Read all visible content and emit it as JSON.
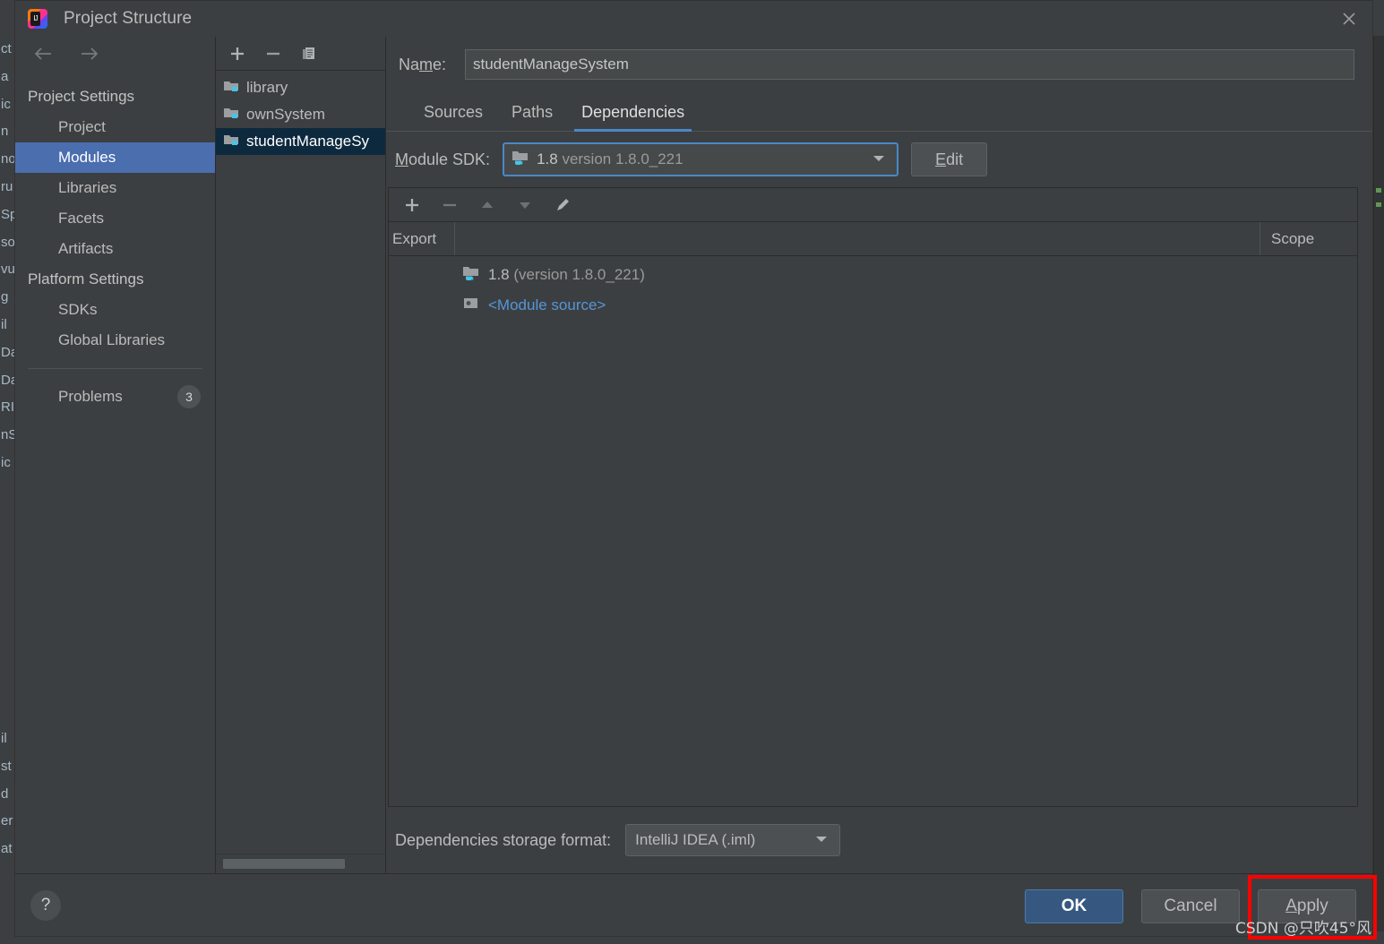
{
  "window": {
    "title": "Project Structure",
    "logo_icon": "intellij-idea-logo",
    "close_icon": "close-icon"
  },
  "sidebar": {
    "back_icon": "arrow-left-icon",
    "forward_icon": "arrow-right-icon",
    "items": [
      {
        "label": "Project Settings",
        "type": "group"
      },
      {
        "label": "Project",
        "type": "child"
      },
      {
        "label": "Modules",
        "type": "child",
        "selected": true
      },
      {
        "label": "Libraries",
        "type": "child"
      },
      {
        "label": "Facets",
        "type": "child"
      },
      {
        "label": "Artifacts",
        "type": "child"
      },
      {
        "label": "Platform Settings",
        "type": "group"
      },
      {
        "label": "SDKs",
        "type": "child"
      },
      {
        "label": "Global Libraries",
        "type": "child"
      }
    ],
    "problems": {
      "label": "Problems",
      "count": "3"
    }
  },
  "modules_panel": {
    "toolbar": [
      {
        "name": "add-module-button",
        "icon": "plus-icon"
      },
      {
        "name": "remove-module-button",
        "icon": "minus-icon"
      },
      {
        "name": "copy-module-button",
        "icon": "copy-icon"
      }
    ],
    "modules": [
      {
        "label": "library",
        "icon": "module-folder-icon",
        "selected": false
      },
      {
        "label": "ownSystem",
        "icon": "module-folder-icon",
        "selected": false
      },
      {
        "label": "studentManageSy",
        "icon": "module-folder-icon",
        "selected": true
      }
    ]
  },
  "main": {
    "name_label": "Name:",
    "name_value": "studentManageSystem",
    "name_placeholder": "",
    "tabs": [
      {
        "label": "Sources",
        "active": false
      },
      {
        "label": "Paths",
        "active": false
      },
      {
        "label": "Dependencies",
        "active": true
      }
    ],
    "sdk_label": "Module SDK:",
    "sdk_value_bold": "1.8",
    "sdk_value_dim": "version 1.8.0_221",
    "sdk_icon": "jdk-icon",
    "sdk_caret_icon": "chevron-down-icon",
    "edit_button": "Edit",
    "deps_toolbar": [
      {
        "name": "add-dependency-button",
        "icon": "plus-icon"
      },
      {
        "name": "remove-dependency-button",
        "icon": "minus-icon"
      },
      {
        "name": "move-up-button",
        "icon": "triangle-up-icon"
      },
      {
        "name": "move-down-button",
        "icon": "triangle-down-icon"
      },
      {
        "name": "edit-dependency-button",
        "icon": "pencil-icon"
      }
    ],
    "table": {
      "columns": [
        "Export",
        "Scope"
      ],
      "rows": [
        {
          "icon": "jdk-icon",
          "name_bold": "1.8",
          "name_dim": "(version 1.8.0_221)",
          "link": false,
          "scope": ""
        },
        {
          "icon": "module-source-icon",
          "name_bold": "<Module source>",
          "name_dim": "",
          "link": true,
          "scope": ""
        }
      ]
    },
    "storage_label": "Dependencies storage format:",
    "storage_value": "IntelliJ IDEA (.iml)",
    "storage_caret_icon": "chevron-down-icon"
  },
  "footer": {
    "help_icon": "question-mark-icon",
    "ok_button": "OK",
    "cancel_button": "Cancel",
    "apply_button": "Apply",
    "apply_mnemonic": "A",
    "annotation_color": "#ff0000"
  },
  "watermark": {
    "text": "CSDN @只吹45°风"
  },
  "ide_background": {
    "left_strip": [
      "ct",
      "a",
      "ic",
      "n",
      "no",
      "ru",
      "Sp",
      "so",
      "vu",
      "g",
      "il",
      "Da",
      "Da",
      "RI",
      "nS",
      "ic",
      "",
      "",
      "",
      "",
      "",
      "",
      "",
      "",
      "",
      "il",
      "st",
      "d",
      "er",
      "at"
    ]
  },
  "colors": {
    "dialog_bg": "#3c3f41",
    "accent_blue": "#4a88c7",
    "selection_blue": "#4b6eaf",
    "module_selection": "#0d293e",
    "link_blue": "#5596d8",
    "primary_button": "#365880"
  }
}
